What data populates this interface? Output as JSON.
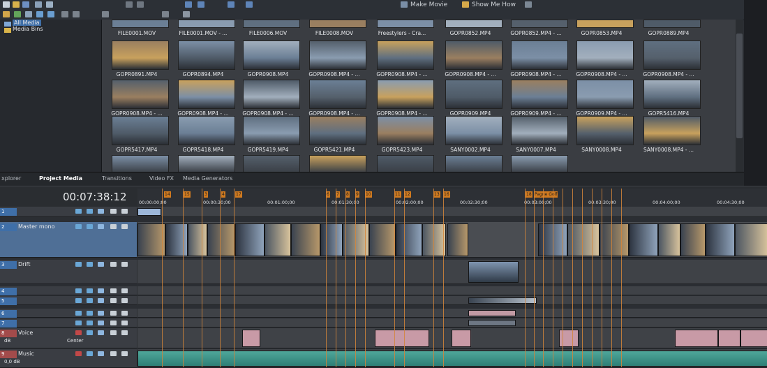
{
  "toolbar": {
    "make_movie": "Make Movie",
    "show_me_how": "Show Me How"
  },
  "tree": {
    "items": [
      {
        "label": "All Media"
      },
      {
        "label": "Media Bins"
      }
    ]
  },
  "media": {
    "rows": [
      [
        "FILE0001.MOV",
        "FILE0001.MOV - ...",
        "FILE0006.MOV",
        "FILE0008.MOV",
        "Freestylers - Cra...",
        "GOPR0852.MP4",
        "GOPR0852.MP4 - ...",
        "GOPR0853.MP4",
        "GOPR0889.MP4"
      ],
      [
        "GOPR0891.MP4",
        "GOPR0894.MP4",
        "GOPR0908.MP4",
        "GOPR0908.MP4 - ...",
        "GOPR0908.MP4 - ...",
        "GOPR0908.MP4 - ...",
        "GOPR0908.MP4 - ...",
        "GOPR0908.MP4 - ...",
        "GOPR0908.MP4 - ..."
      ],
      [
        "GOPR0908.MP4 - ...",
        "GOPR0908.MP4 - ...",
        "GOPR0908.MP4 - ...",
        "GOPR0908.MP4 - ...",
        "GOPR0908.MP4 - ...",
        "GOPR0909.MP4",
        "GOPR0909.MP4 - ...",
        "GOPR0909.MP4 - ...",
        "GOPR5416.MP4"
      ],
      [
        "GOPR5417.MP4",
        "GOPR5418.MP4",
        "GOPR5419.MP4",
        "GOPR5421.MP4",
        "GOPR5423.MP4",
        "SANY0002.MP4",
        "SANY0007.MP4",
        "SANY0008.MP4",
        "SANY0008.MP4 - ..."
      ]
    ]
  },
  "tabs": {
    "explorer": "xplorer",
    "project_media": "Project Media",
    "transitions": "Transitions",
    "video_fx": "Video FX",
    "media_generators": "Media Generators"
  },
  "timeline": {
    "timecode": "00:07:38:12",
    "ticks": [
      "00:00:00;00",
      "00:00:30;00",
      "00:01:00;00",
      "00:01:30;00",
      "00:02:00;00",
      "00:02:30;00",
      "00:03:00;00",
      "00:03:30;00",
      "00:04:00;00",
      "00:04:30;00"
    ],
    "markers": [
      "14",
      "15",
      "3",
      "4",
      "17",
      "6",
      "7",
      "8",
      "9",
      "10",
      "11",
      "12",
      "13",
      "16",
      "18",
      "Pagne Golf"
    ]
  },
  "tracks": [
    {
      "num": "1",
      "name": ""
    },
    {
      "num": "2",
      "name": "Master mono"
    },
    {
      "num": "3",
      "name": "Drift"
    },
    {
      "num": "4",
      "name": ""
    },
    {
      "num": "5",
      "name": ""
    },
    {
      "num": "6",
      "name": ""
    },
    {
      "num": "7",
      "name": ""
    },
    {
      "num": "8",
      "name": "Voice",
      "db": "dB",
      "pan": "Center"
    },
    {
      "num": "9",
      "name": "Music",
      "db": "0,0 dB"
    }
  ]
}
